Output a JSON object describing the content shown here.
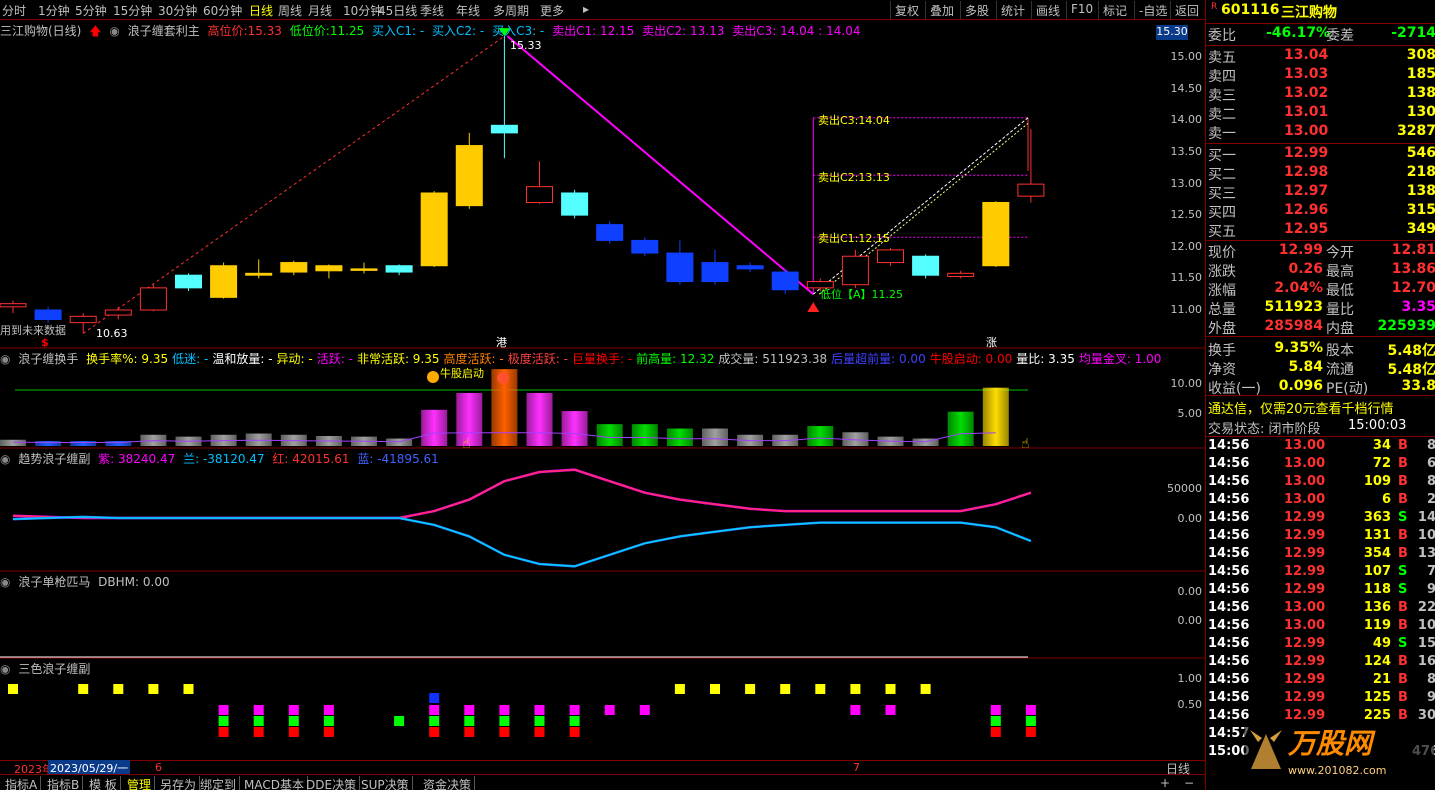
{
  "toolbar": {
    "periods": [
      "分时",
      "1分钟",
      "5分钟",
      "15分钟",
      "30分钟",
      "60分钟",
      "日线",
      "周线",
      "月线",
      "10分钟",
      "45日线",
      "季线",
      "年线",
      "多周期",
      "更多"
    ],
    "active_period": "日线",
    "buttons": [
      "复权",
      "叠加",
      "多股",
      "统计",
      "画线",
      "F10",
      "标记",
      "-自选",
      "返回"
    ]
  },
  "main_pane": {
    "stock": "三江购物(日线)",
    "indicator": "浪子缠套利主",
    "high_label": "高位价:",
    "high_value": "15.33",
    "low_label": "低位价:",
    "low_value": "11.25",
    "buy1": "买入C1: -",
    "buy2": "买入C2: -",
    "buy3": "买入C3: -",
    "sell1": "卖出C1: 12.15",
    "sell2": "卖出C2: 13.13",
    "sell3": "卖出C3: 14.04 : 14.04",
    "future_note": "用到未来数据",
    "peak_label": "15.33",
    "low_annot": "10.63",
    "sell_c1_tag": "卖出C1:12.15",
    "sell_c2_tag": "卖出C2:13.13",
    "sell_c3_tag": "卖出C3:14.04",
    "low_tag": "低位【A】11.25",
    "price_ticks": [
      "15.00",
      "14.50",
      "14.00",
      "13.50",
      "13.00",
      "12.50",
      "12.00",
      "11.50",
      "11.00"
    ],
    "current_price_tag": "15.30",
    "markers": [
      "$",
      "港",
      "涨"
    ]
  },
  "pane2": {
    "name": "浪子缠换手",
    "items": [
      {
        "t": "换手率%: 9.35",
        "c": "#ffff00"
      },
      {
        "t": "低迷: -",
        "c": "#00c0ff"
      },
      {
        "t": "温和放量: -",
        "c": "#ffffff"
      },
      {
        "t": "异动: -",
        "c": "#ffff00"
      },
      {
        "t": "活跃: -",
        "c": "#ff00ff"
      },
      {
        "t": "非常活跃: 9.35",
        "c": "#ffff00"
      },
      {
        "t": "高度活跃: -",
        "c": "#ff8000"
      },
      {
        "t": "极度活跃: -",
        "c": "#ff4040"
      },
      {
        "t": "巨量换手: -",
        "c": "#ff0000"
      },
      {
        "t": "前高量: 12.32",
        "c": "#00ff00"
      },
      {
        "t": "成交量: 511923.38",
        "c": "#c0c0c0"
      },
      {
        "t": "后量超前量: 0.00",
        "c": "#4040ff"
      },
      {
        "t": "牛股启动: 0.00",
        "c": "#ff0000"
      },
      {
        "t": "量比: 3.35",
        "c": "#ffffff"
      },
      {
        "t": "均量金叉: 1.00",
        "c": "#ff00ff"
      }
    ],
    "start_tag": "牛股启动",
    "ticks": [
      "10.00",
      "5.00"
    ]
  },
  "pane3": {
    "name": "趋势浪子缠副",
    "purple": "紫: 38240.47",
    "blue": "兰: -38120.47",
    "red": "红: 42015.61",
    "cyan": "蓝: -41895.61",
    "ticks": [
      "50000",
      "0.00"
    ]
  },
  "pane4": {
    "name": "浪子单枪匹马",
    "value": "DBHM: 0.00",
    "ticks": [
      "0.00",
      "0.00"
    ]
  },
  "pane5": {
    "name": "三色浪子缠副",
    "ticks": [
      "1.00",
      "0.50"
    ]
  },
  "date_bar": {
    "start": "2023年",
    "cursor": "2023/05/29/一",
    "m6": "6",
    "m7": "7",
    "period": "日线"
  },
  "bottom_tabs": [
    "指标A",
    "指标B",
    "模 板",
    "管理",
    "另存为",
    "绑定到",
    "MACD基本",
    "DDE决策",
    "SUP决策",
    "资金决策"
  ],
  "quote": {
    "code": "601116",
    "name": "三江购物",
    "wb_label": "委比",
    "wb_value": "-46.17%",
    "wc_label": "委差",
    "wc_value": "-2714",
    "asks": [
      {
        "label": "卖五",
        "price": "13.04",
        "vol": "308"
      },
      {
        "label": "卖四",
        "price": "13.03",
        "vol": "185"
      },
      {
        "label": "卖三",
        "price": "13.02",
        "vol": "138"
      },
      {
        "label": "卖二",
        "price": "13.01",
        "vol": "130"
      },
      {
        "label": "卖一",
        "price": "13.00",
        "vol": "3287"
      }
    ],
    "bids": [
      {
        "label": "买一",
        "price": "12.99",
        "vol": "546"
      },
      {
        "label": "买二",
        "price": "12.98",
        "vol": "218"
      },
      {
        "label": "买三",
        "price": "12.97",
        "vol": "138"
      },
      {
        "label": "买四",
        "price": "12.96",
        "vol": "315"
      },
      {
        "label": "买五",
        "price": "12.95",
        "vol": "349"
      }
    ],
    "stats": [
      {
        "l1": "现价",
        "v1": "12.99",
        "c1": "#ff3030",
        "l2": "今开",
        "v2": "12.81",
        "c2": "#ff3030"
      },
      {
        "l1": "涨跌",
        "v1": "0.26",
        "c1": "#ff3030",
        "l2": "最高",
        "v2": "13.86",
        "c2": "#ff3030"
      },
      {
        "l1": "涨幅",
        "v1": "2.04%",
        "c1": "#ff3030",
        "l2": "最低",
        "v2": "12.70",
        "c2": "#ff3030"
      },
      {
        "l1": "总量",
        "v1": "511923",
        "c1": "#ffff00",
        "l2": "量比",
        "v2": "3.35",
        "c2": "#ff00ff"
      },
      {
        "l1": "外盘",
        "v1": "285984",
        "c1": "#ff3030",
        "l2": "内盘",
        "v2": "225939",
        "c2": "#00ff00"
      },
      {
        "l1": "换手",
        "v1": "9.35%",
        "c1": "#ffff00",
        "l2": "股本",
        "v2": "5.48亿",
        "c2": "#ffff00"
      },
      {
        "l1": "净资",
        "v1": "5.84",
        "c1": "#ffff00",
        "l2": "流通",
        "v2": "5.48亿",
        "c2": "#ffff00"
      },
      {
        "l1": "收益(一)",
        "v1": "0.096",
        "c1": "#ffff00",
        "l2": "PE(动)",
        "v2": "33.8",
        "c2": "#ffff00"
      }
    ],
    "promo": "通达信，仅需20元查看千档行情",
    "state_label": "交易状态: 闭市阶段",
    "state_time": "15:00:03",
    "ticks": [
      {
        "t": "14:56",
        "p": "13.00",
        "v": "34",
        "bs": "B",
        "x": "8"
      },
      {
        "t": "14:56",
        "p": "13.00",
        "v": "72",
        "bs": "B",
        "x": "6"
      },
      {
        "t": "14:56",
        "p": "13.00",
        "v": "109",
        "bs": "B",
        "x": "8"
      },
      {
        "t": "14:56",
        "p": "13.00",
        "v": "6",
        "bs": "B",
        "x": "2"
      },
      {
        "t": "14:56",
        "p": "12.99",
        "v": "363",
        "bs": "S",
        "x": "14"
      },
      {
        "t": "14:56",
        "p": "12.99",
        "v": "131",
        "bs": "B",
        "x": "10"
      },
      {
        "t": "14:56",
        "p": "12.99",
        "v": "354",
        "bs": "B",
        "x": "13"
      },
      {
        "t": "14:56",
        "p": "12.99",
        "v": "107",
        "bs": "S",
        "x": "7"
      },
      {
        "t": "14:56",
        "p": "12.99",
        "v": "118",
        "bs": "S",
        "x": "9"
      },
      {
        "t": "14:56",
        "p": "13.00",
        "v": "136",
        "bs": "B",
        "x": "22"
      },
      {
        "t": "14:56",
        "p": "13.00",
        "v": "119",
        "bs": "B",
        "x": "10"
      },
      {
        "t": "14:56",
        "p": "12.99",
        "v": "49",
        "bs": "S",
        "x": "15"
      },
      {
        "t": "14:56",
        "p": "12.99",
        "v": "124",
        "bs": "B",
        "x": "16"
      },
      {
        "t": "14:56",
        "p": "12.99",
        "v": "21",
        "bs": "B",
        "x": "8"
      },
      {
        "t": "14:56",
        "p": "12.99",
        "v": "125",
        "bs": "B",
        "x": "9"
      },
      {
        "t": "14:56",
        "p": "12.99",
        "v": "225",
        "bs": "B",
        "x": "30"
      },
      {
        "t": "14:57",
        "p": "",
        "v": "",
        "bs": "",
        "x": ""
      },
      {
        "t": "15:00",
        "p": "",
        "v": "",
        "bs": "",
        "x": "476"
      }
    ],
    "logo": "万股网",
    "logo_url": "www.201082.com"
  },
  "candles": [
    {
      "o": 11.05,
      "c": 11.1,
      "h": 11.15,
      "l": 10.95
    },
    {
      "o": 11.0,
      "c": 10.85,
      "h": 11.05,
      "l": 10.8
    },
    {
      "o": 10.8,
      "c": 10.9,
      "h": 10.95,
      "l": 10.63
    },
    {
      "o": 10.92,
      "c": 11.0,
      "h": 11.05,
      "l": 10.85
    },
    {
      "o": 11.0,
      "c": 11.35,
      "h": 11.4,
      "l": 10.98
    },
    {
      "o": 11.35,
      "c": 11.55,
      "h": 11.58,
      "l": 11.3
    },
    {
      "o": 11.2,
      "c": 11.7,
      "h": 11.75,
      "l": 11.18
    },
    {
      "o": 11.55,
      "c": 11.58,
      "h": 11.8,
      "l": 11.5
    },
    {
      "o": 11.6,
      "c": 11.75,
      "h": 11.78,
      "l": 11.55
    },
    {
      "o": 11.62,
      "c": 11.7,
      "h": 11.72,
      "l": 11.5
    },
    {
      "o": 11.65,
      "c": 11.63,
      "h": 11.75,
      "l": 11.58
    },
    {
      "o": 11.6,
      "c": 11.7,
      "h": 11.72,
      "l": 11.55
    },
    {
      "o": 11.7,
      "c": 12.85,
      "h": 12.88,
      "l": 11.68
    },
    {
      "o": 12.65,
      "c": 13.6,
      "h": 13.8,
      "l": 12.6
    },
    {
      "o": 13.8,
      "c": 13.92,
      "h": 15.33,
      "l": 13.4
    },
    {
      "o": 12.7,
      "c": 12.95,
      "h": 13.35,
      "l": 12.68
    },
    {
      "o": 12.85,
      "c": 12.5,
      "h": 12.9,
      "l": 12.45
    },
    {
      "o": 12.35,
      "c": 12.1,
      "h": 12.4,
      "l": 12.05
    },
    {
      "o": 12.1,
      "c": 11.9,
      "h": 12.15,
      "l": 11.85
    },
    {
      "o": 11.9,
      "c": 11.45,
      "h": 12.1,
      "l": 11.4
    },
    {
      "o": 11.75,
      "c": 11.45,
      "h": 11.95,
      "l": 11.4
    },
    {
      "o": 11.7,
      "c": 11.65,
      "h": 11.75,
      "l": 11.6
    },
    {
      "o": 11.6,
      "c": 11.32,
      "h": 11.65,
      "l": 11.25
    },
    {
      "o": 11.35,
      "c": 11.45,
      "h": 11.5,
      "l": 11.3
    },
    {
      "o": 11.4,
      "c": 11.85,
      "h": 11.95,
      "l": 11.35
    },
    {
      "o": 11.75,
      "c": 11.95,
      "h": 11.98,
      "l": 11.7
    },
    {
      "o": 11.85,
      "c": 11.55,
      "h": 11.88,
      "l": 11.5
    },
    {
      "o": 11.53,
      "c": 11.58,
      "h": 11.62,
      "l": 11.5
    },
    {
      "o": 11.7,
      "c": 12.7,
      "h": 12.72,
      "l": 11.68
    },
    {
      "o": 12.8,
      "c": 12.99,
      "h": 13.86,
      "l": 12.7
    }
  ],
  "candle_colors": [
    "r",
    "b",
    "r",
    "r",
    "r",
    "c",
    "y",
    "y",
    "y",
    "y",
    "y",
    "c",
    "y",
    "y",
    "c",
    "r",
    "c",
    "b",
    "b",
    "b",
    "b",
    "b",
    "b",
    "r",
    "r",
    "r",
    "c",
    "r",
    "y",
    "r"
  ],
  "turnover": [
    1.0,
    0.8,
    0.8,
    0.8,
    1.8,
    1.5,
    1.8,
    2.0,
    1.8,
    1.6,
    1.5,
    1.2,
    5.8,
    8.5,
    12.32,
    8.5,
    5.6,
    3.5,
    3.5,
    2.8,
    2.8,
    1.8,
    1.8,
    3.2,
    2.2,
    1.5,
    1.2,
    5.5,
    9.35
  ],
  "turnover_colors": [
    "g",
    "b",
    "b",
    "b",
    "g",
    "g",
    "g",
    "g",
    "g",
    "g",
    "g",
    "g",
    "m",
    "m",
    "o",
    "m",
    "m",
    "gr",
    "gr",
    "gr",
    "g",
    "g",
    "g",
    "gr",
    "g",
    "g",
    "g",
    "gr",
    "y"
  ],
  "trend_red": [
    0.1,
    0.05,
    0,
    0,
    0,
    0,
    0,
    0,
    0,
    0,
    0,
    0,
    0.3,
    0.8,
    1.6,
    2.0,
    2.1,
    1.6,
    1.1,
    0.8,
    0.6,
    0.4,
    0.3,
    0.3,
    0.3,
    0.3,
    0.3,
    0.3,
    0.6,
    1.1
  ],
  "trend_blue": [
    -0.05,
    0,
    0.05,
    0,
    0,
    0,
    0,
    0,
    0,
    0,
    0,
    0,
    -0.3,
    -0.8,
    -1.6,
    -2.0,
    -2.1,
    -1.6,
    -1.1,
    -0.8,
    -0.6,
    -0.4,
    -0.3,
    -0.2,
    -0.2,
    -0.2,
    -0.2,
    -0.2,
    -0.4,
    -1.0
  ]
}
